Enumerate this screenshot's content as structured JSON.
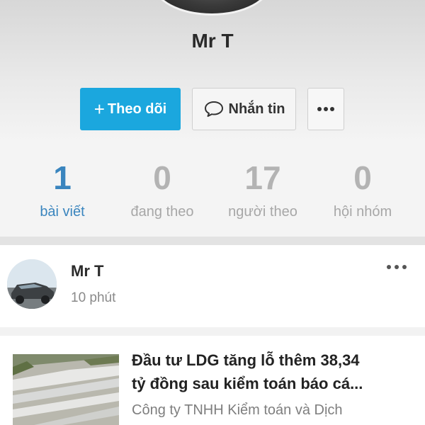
{
  "profile": {
    "name": "Mr T",
    "follow_label": "Theo dõi",
    "follow_icon": "plus-icon",
    "message_label": "Nhắn tin",
    "message_icon": "chat-bubble-icon",
    "more_icon": "more-horizontal-icon"
  },
  "stats": [
    {
      "value": "1",
      "label": "bài viết",
      "active": true
    },
    {
      "value": "0",
      "label": "đang theo",
      "active": false
    },
    {
      "value": "17",
      "label": "người theo",
      "active": false
    },
    {
      "value": "0",
      "label": "hội nhóm",
      "active": false
    }
  ],
  "post": {
    "author": "Mr T",
    "time": "10 phút",
    "more_icon": "more-horizontal-icon",
    "article": {
      "title_line1": "Đầu tư LDG tăng lỗ thêm 38,34",
      "title_line2": "tỷ đồng sau kiểm toán báo cá...",
      "source": "Công ty TNHH Kiểm toán và Dịch"
    }
  },
  "colors": {
    "accent": "#1ba7de",
    "active_stat": "#3a85be",
    "inactive_stat": "#b3b3b3"
  }
}
